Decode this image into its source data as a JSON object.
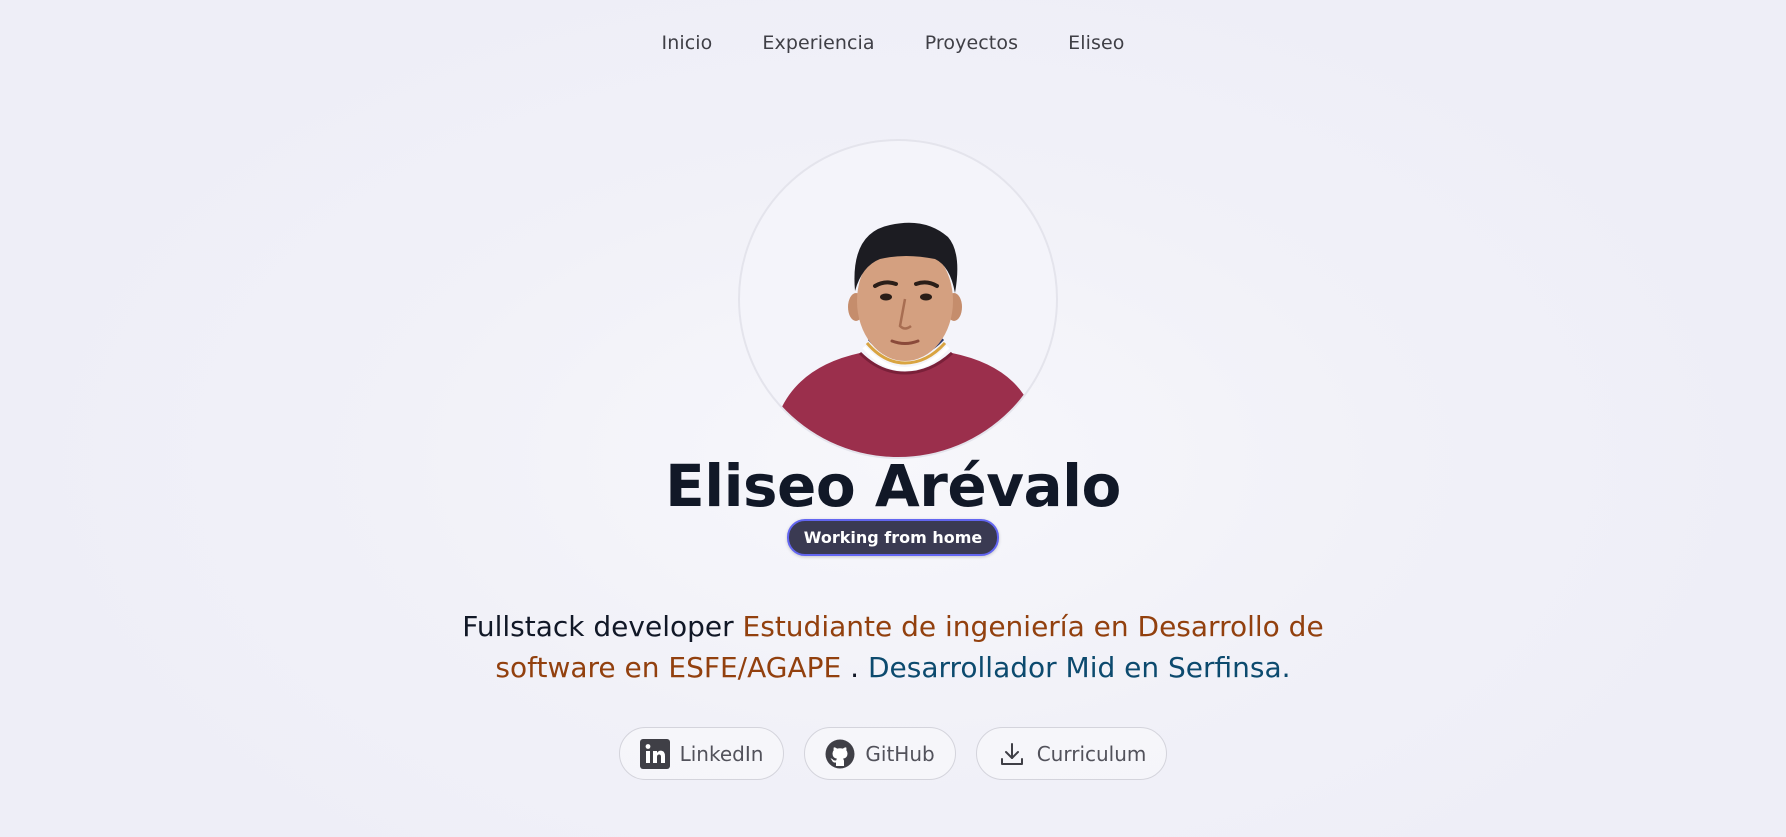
{
  "nav": {
    "items": [
      {
        "label": "Inicio"
      },
      {
        "label": "Experiencia"
      },
      {
        "label": "Proyectos"
      },
      {
        "label": "Eliseo"
      }
    ]
  },
  "profile": {
    "avatar_icon": "profile-photo",
    "name": "Eliseo Arévalo",
    "status": "Working from home"
  },
  "bio": {
    "role": "Fullstack developer",
    "study": "Estudiante de ingeniería en Desarrollo de software en ESFE/AGAPE",
    "separator": ".",
    "job": "Desarrollador Mid en Serfinsa."
  },
  "links": [
    {
      "label": "LinkedIn",
      "icon": "linkedin-icon"
    },
    {
      "label": "GitHub",
      "icon": "github-icon"
    },
    {
      "label": "Curriculum",
      "icon": "download-icon"
    }
  ],
  "colors": {
    "accent_amber": "#92400e",
    "accent_blue": "#0c4a6e",
    "badge_bg": "#3a3a52",
    "badge_border": "#6366f1"
  }
}
